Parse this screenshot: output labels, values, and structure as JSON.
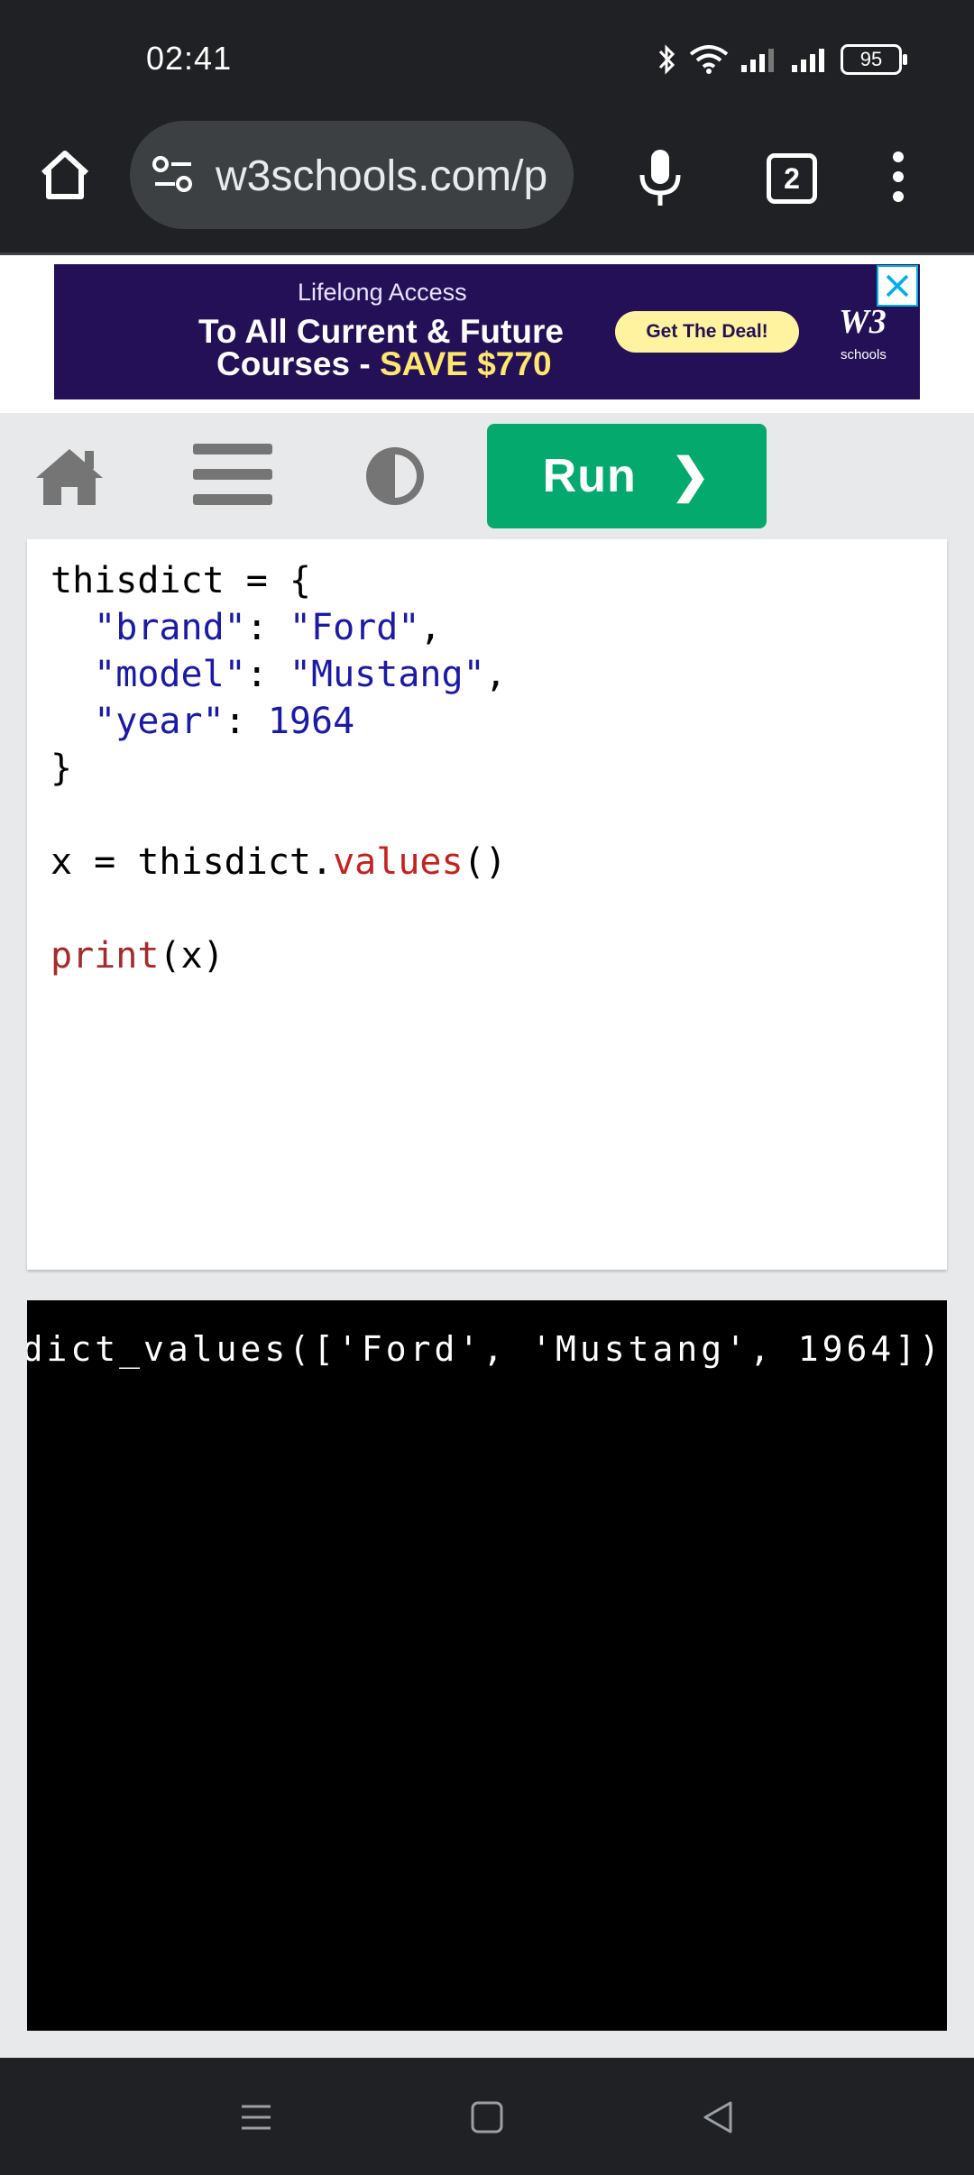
{
  "status_bar": {
    "time": "02:41",
    "battery": "95"
  },
  "browser": {
    "url": "w3schools.com/p",
    "tab_count": "2"
  },
  "ad": {
    "line1": "Lifelong Access",
    "line2": "To All Current & Future",
    "line3_prefix": "Courses  - ",
    "line3_accent": "SAVE $770",
    "cta": "Get The Deal!",
    "logo": "W3",
    "logo_sub": "schools"
  },
  "toolbar": {
    "run_label": "Run",
    "run_arrow": "❯"
  },
  "editor": {
    "lines": [
      "thisdict = {",
      "  \"brand\": \"Ford\",",
      "  \"model\": \"Mustang\",",
      "  \"year\": 1964",
      "}",
      "",
      "x = thisdict.values()",
      "",
      "print(x)"
    ]
  },
  "output": {
    "text": "dict_values(['Ford', 'Mustang', 1964])"
  },
  "colors": {
    "run_button": "#04aa6d",
    "browser_chrome": "#202124",
    "ad_background": "#241056"
  }
}
